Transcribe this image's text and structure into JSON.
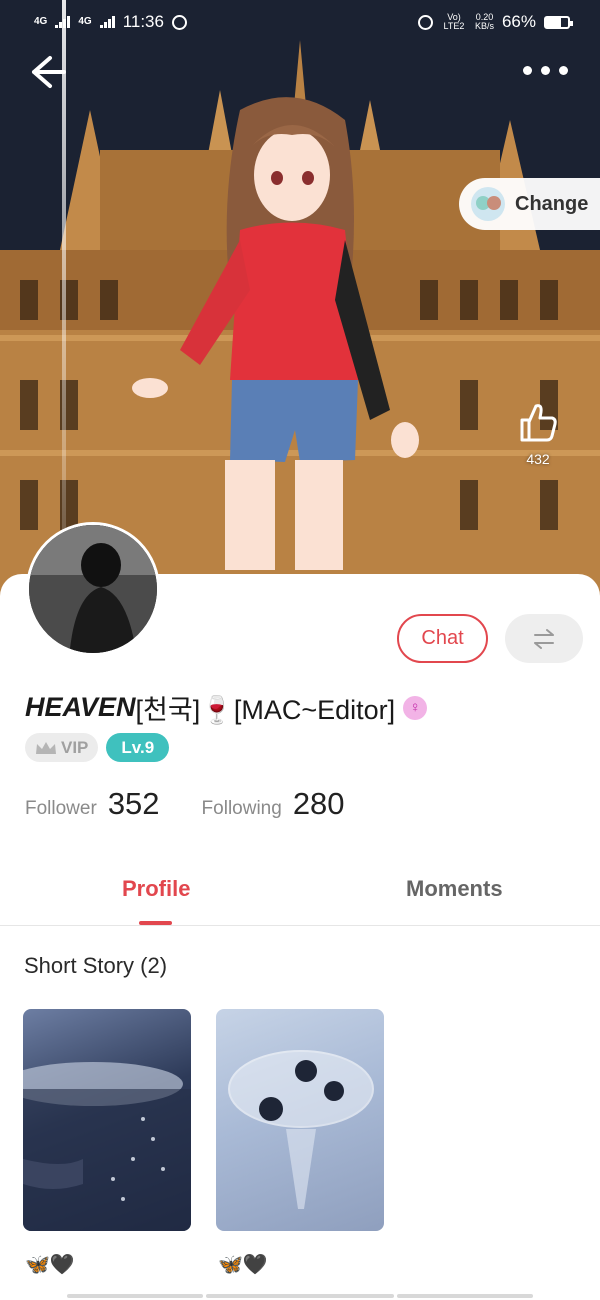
{
  "status_bar": {
    "network_1": "4G",
    "network_2": "4G",
    "time": "11:36",
    "volte": "Vo) LTE2",
    "speed_value": "0.20",
    "speed_unit": "KB/s",
    "battery": "66%",
    "battery_level": 0.66
  },
  "header": {
    "change_label": "Change"
  },
  "likes": {
    "count": "432"
  },
  "profile": {
    "name_bold": "HEAVEN",
    "name_rest": "[천국]🍷[MAC~Editor]",
    "gender_symbol": "♀",
    "vip_label": "VIP",
    "level_label": "Lv.9",
    "follower_label": "Follower",
    "follower_count": "352",
    "following_label": "Following",
    "following_count": "280",
    "chat_label": "Chat"
  },
  "tabs": [
    {
      "label": "Profile",
      "active": true
    },
    {
      "label": "Moments",
      "active": false
    }
  ],
  "short_story": {
    "title": "Short Story (2)",
    "items": [
      {
        "caption": "🦋🖤"
      },
      {
        "caption": "🦋🖤"
      }
    ]
  },
  "colors": {
    "accent": "#e2474e",
    "level_badge": "#3fc1be",
    "vip_badge": "#ececec"
  }
}
